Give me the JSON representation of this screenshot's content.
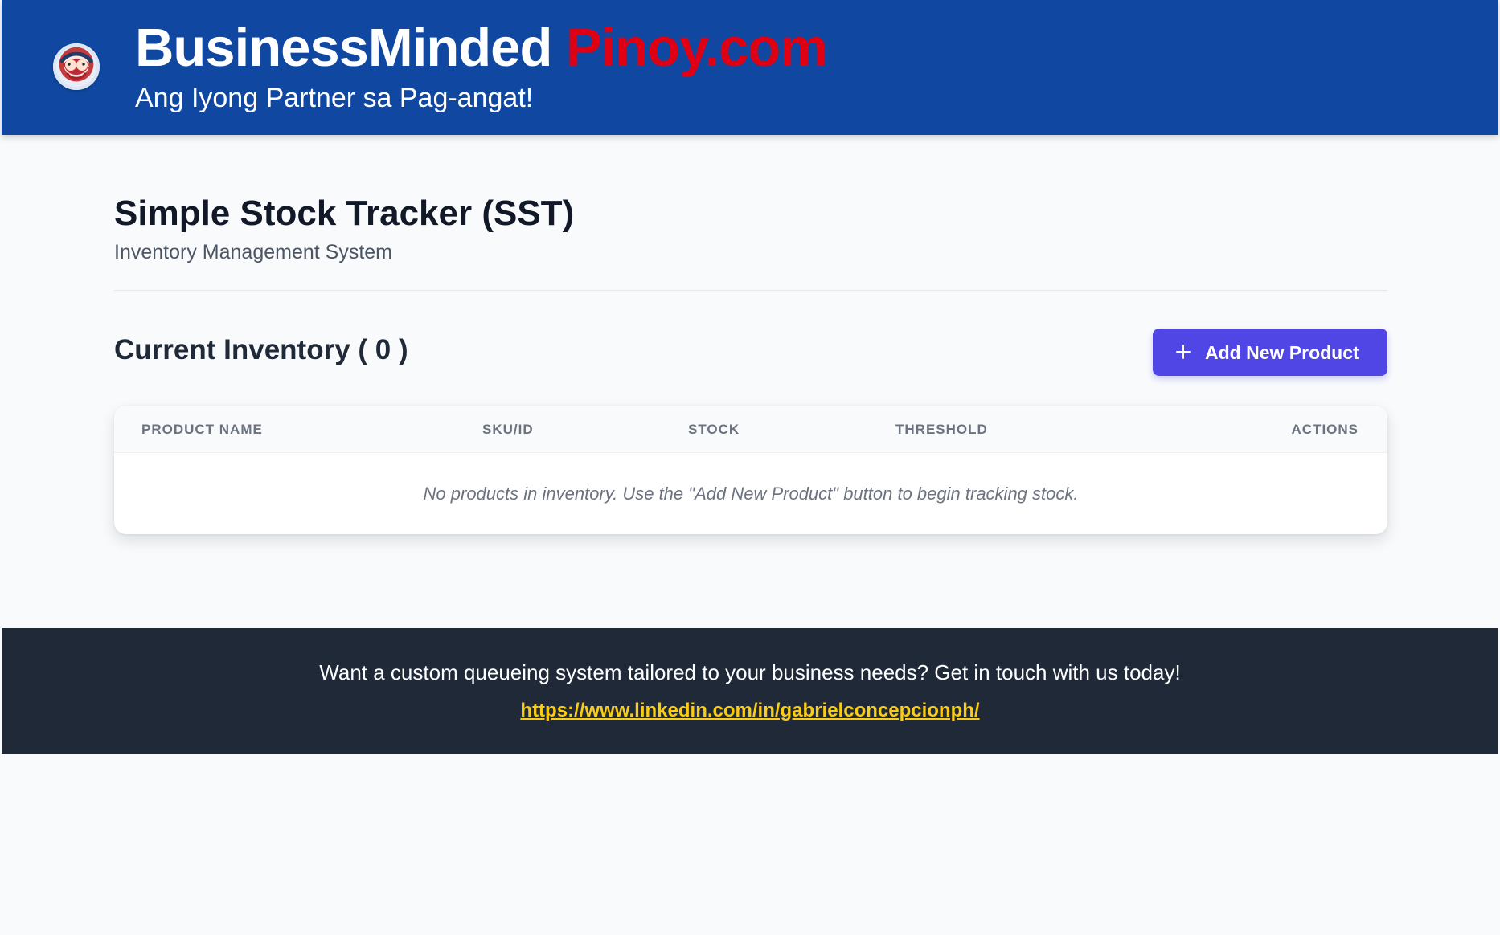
{
  "header": {
    "brand_white": "BusinessMinded ",
    "brand_red": "Pinoy.com",
    "subtitle": "Ang Iyong Partner sa Pag-angat!"
  },
  "main": {
    "title": "Simple Stock Tracker (SST)",
    "subtitle": "Inventory Management System",
    "section_title": "Current Inventory ( 0 )",
    "add_button_label": "Add New Product",
    "table": {
      "columns": [
        "PRODUCT NAME",
        "SKU/ID",
        "STOCK",
        "THRESHOLD",
        "ACTIONS"
      ],
      "empty_message": "No products in inventory. Use the \"Add New Product\" button to begin tracking stock."
    }
  },
  "footer": {
    "text": "Want a custom queueing system tailored to your business needs? Get in touch with us today!",
    "link_text": "https://www.linkedin.com/in/gabrielconcepcionph/"
  },
  "colors": {
    "header_blue": "#0f47a1",
    "brand_red": "#e00014",
    "button_purple": "#4f46e5",
    "footer_dark": "#1f2937",
    "link_yellow": "#facc15"
  },
  "icons": {
    "logo": "business-logo-icon",
    "add": "plus-icon"
  }
}
